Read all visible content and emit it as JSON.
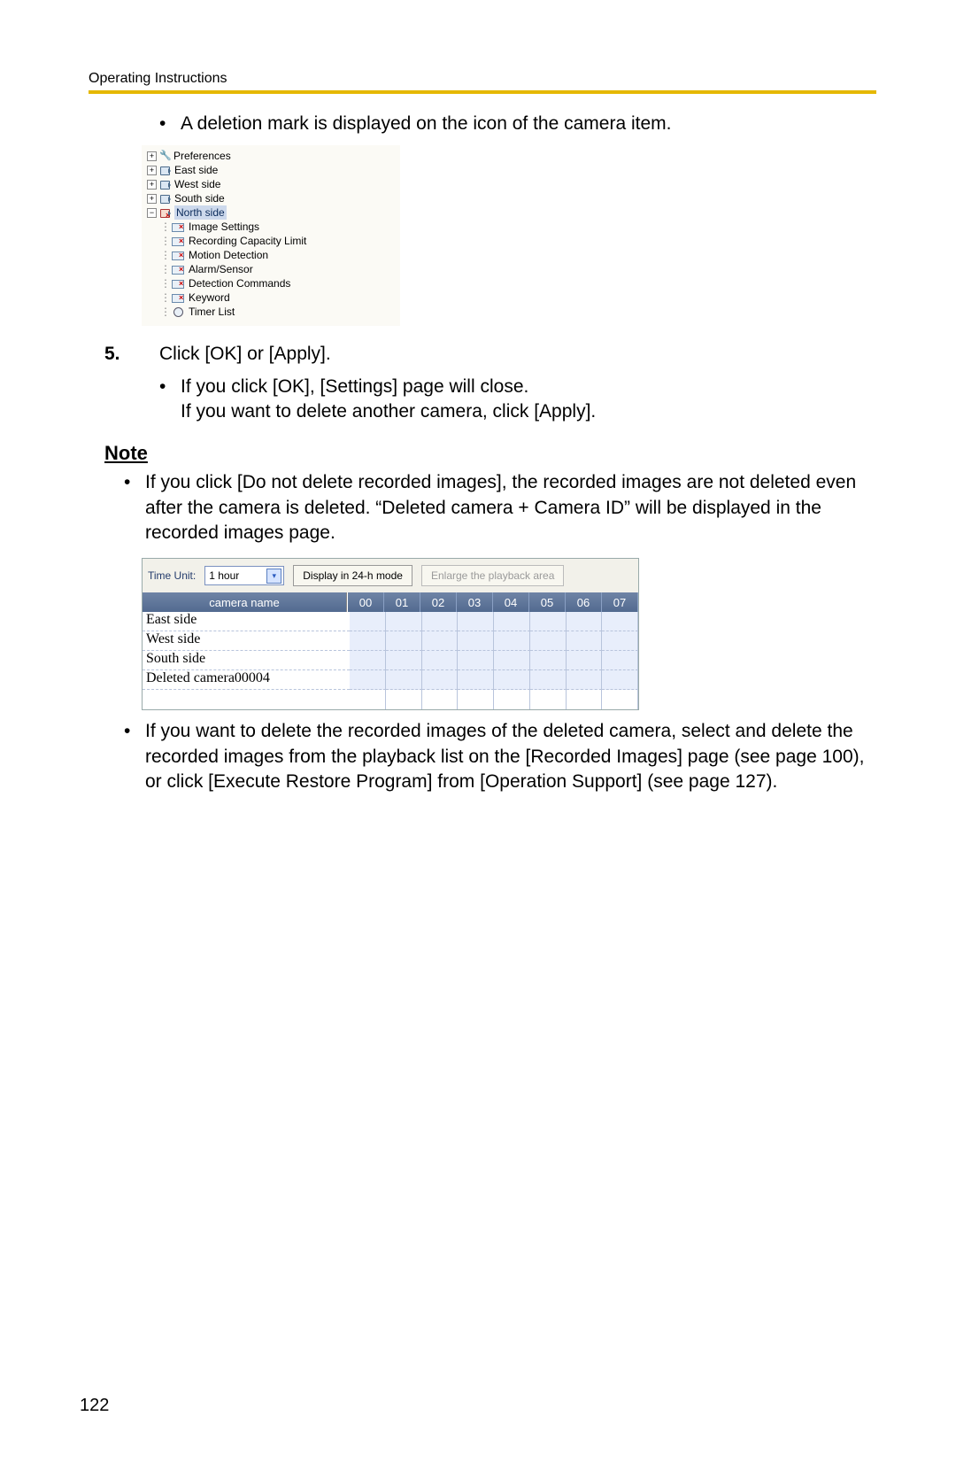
{
  "header": {
    "label": "Operating Instructions"
  },
  "page_number": "122",
  "bullet1": "A deletion mark is displayed on the icon of the camera item.",
  "tree": {
    "top": [
      {
        "label": "Preferences",
        "exp": "+",
        "icon": "wrench"
      },
      {
        "label": "East side",
        "exp": "+",
        "icon": "camera"
      },
      {
        "label": "West side",
        "exp": "+",
        "icon": "camera"
      },
      {
        "label": "South side",
        "exp": "+",
        "icon": "camera"
      },
      {
        "label": "North side",
        "exp": "-",
        "icon": "camera-deleted",
        "selected": true
      }
    ],
    "children": [
      "Image Settings",
      "Recording Capacity Limit",
      "Motion Detection",
      "Alarm/Sensor",
      "Detection Commands",
      "Keyword",
      "Timer List"
    ]
  },
  "step5": {
    "num": "5.",
    "text": "Click [OK] or [Apply].",
    "sub1": "If you click [OK], [Settings] page will close.",
    "sub2": "If you want to delete another camera, click [Apply]."
  },
  "note": {
    "heading": "Note",
    "b1": "If you click [Do not delete recorded images], the recorded images are not deleted even after the camera is deleted. “Deleted camera + Camera ID” will be displayed in the recorded images page.",
    "b2": "If you want to delete the recorded images of the deleted camera, select and delete the recorded images from the playback list on the [Recorded Images] page (see page 100), or click [Execute Restore Program] from [Operation Support] (see page 127)."
  },
  "playback": {
    "time_unit_label": "Time Unit:",
    "time_unit_value": "1 hour",
    "btn_24h": "Display in 24-h mode",
    "btn_enlarge": "Enlarge the playback area",
    "name_header": "camera name",
    "hours": [
      "00",
      "01",
      "02",
      "03",
      "04",
      "05",
      "06",
      "07"
    ],
    "rows": [
      "East side",
      "West side",
      "South side",
      "Deleted camera00004",
      ""
    ]
  },
  "chart_data": {
    "type": "table",
    "title": "Playback list",
    "columns": [
      "camera name",
      "00",
      "01",
      "02",
      "03",
      "04",
      "05",
      "06",
      "07"
    ],
    "rows": [
      [
        "East side",
        "",
        "",
        "",
        "",
        "",
        "",
        "",
        ""
      ],
      [
        "West side",
        "",
        "",
        "",
        "",
        "",
        "",
        "",
        ""
      ],
      [
        "South side",
        "",
        "",
        "",
        "",
        "",
        "",
        "",
        ""
      ],
      [
        "Deleted camera00004",
        "",
        "",
        "",
        "",
        "",
        "",
        "",
        ""
      ]
    ]
  }
}
